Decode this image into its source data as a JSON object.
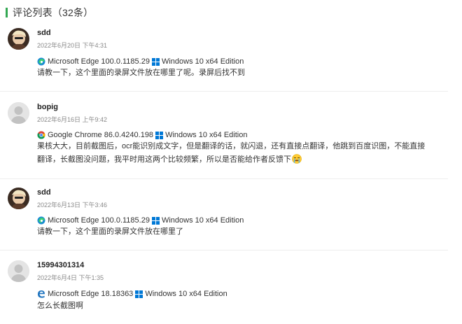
{
  "header": {
    "title": "评论列表（32条）"
  },
  "comments": [
    {
      "author": "sdd",
      "time": "2022年6月20日 下午4:31",
      "browser": "Microsoft Edge 100.0.1185.29",
      "browser_icon": "edge-chromium-icon",
      "os": "Windows 10 x64 Edition",
      "content": "请教一下，这个里面的录屏文件放在哪里了呢。录屏后找不到"
    },
    {
      "author": "bopig",
      "time": "2022年6月16日 上午9:42",
      "browser": "Google Chrome 86.0.4240.198",
      "browser_icon": "chrome-icon",
      "os": "Windows 10 x64 Edition",
      "content_line1": "果核大大，目前截图后，ocr能识别成文字，但是翻译的话，就闪退，还有直接点翻译，他跳到百度识图，不能直接",
      "content_line2": "翻译，长截图没问题，我平时用这两个比较频繁，所以是否能给作者反馈下",
      "emoji": "crying-face-emoji"
    },
    {
      "author": "sdd",
      "time": "2022年6月13日 下午3:46",
      "browser": "Microsoft Edge 100.0.1185.29",
      "browser_icon": "edge-chromium-icon",
      "os": "Windows 10 x64 Edition",
      "content": "请教一下，这个里面的录屏文件放在哪里了"
    },
    {
      "author": "15994301314",
      "time": "2022年6月4日 下午1:35",
      "browser": "Microsoft Edge 18.18363",
      "browser_icon": "edge-legacy-icon",
      "os": "Windows 10 x64 Edition",
      "content": "怎么长截图啊"
    }
  ],
  "colors": {
    "accent": "#34a853",
    "windows": "#0078d6",
    "meta": "#8a8a8a"
  }
}
